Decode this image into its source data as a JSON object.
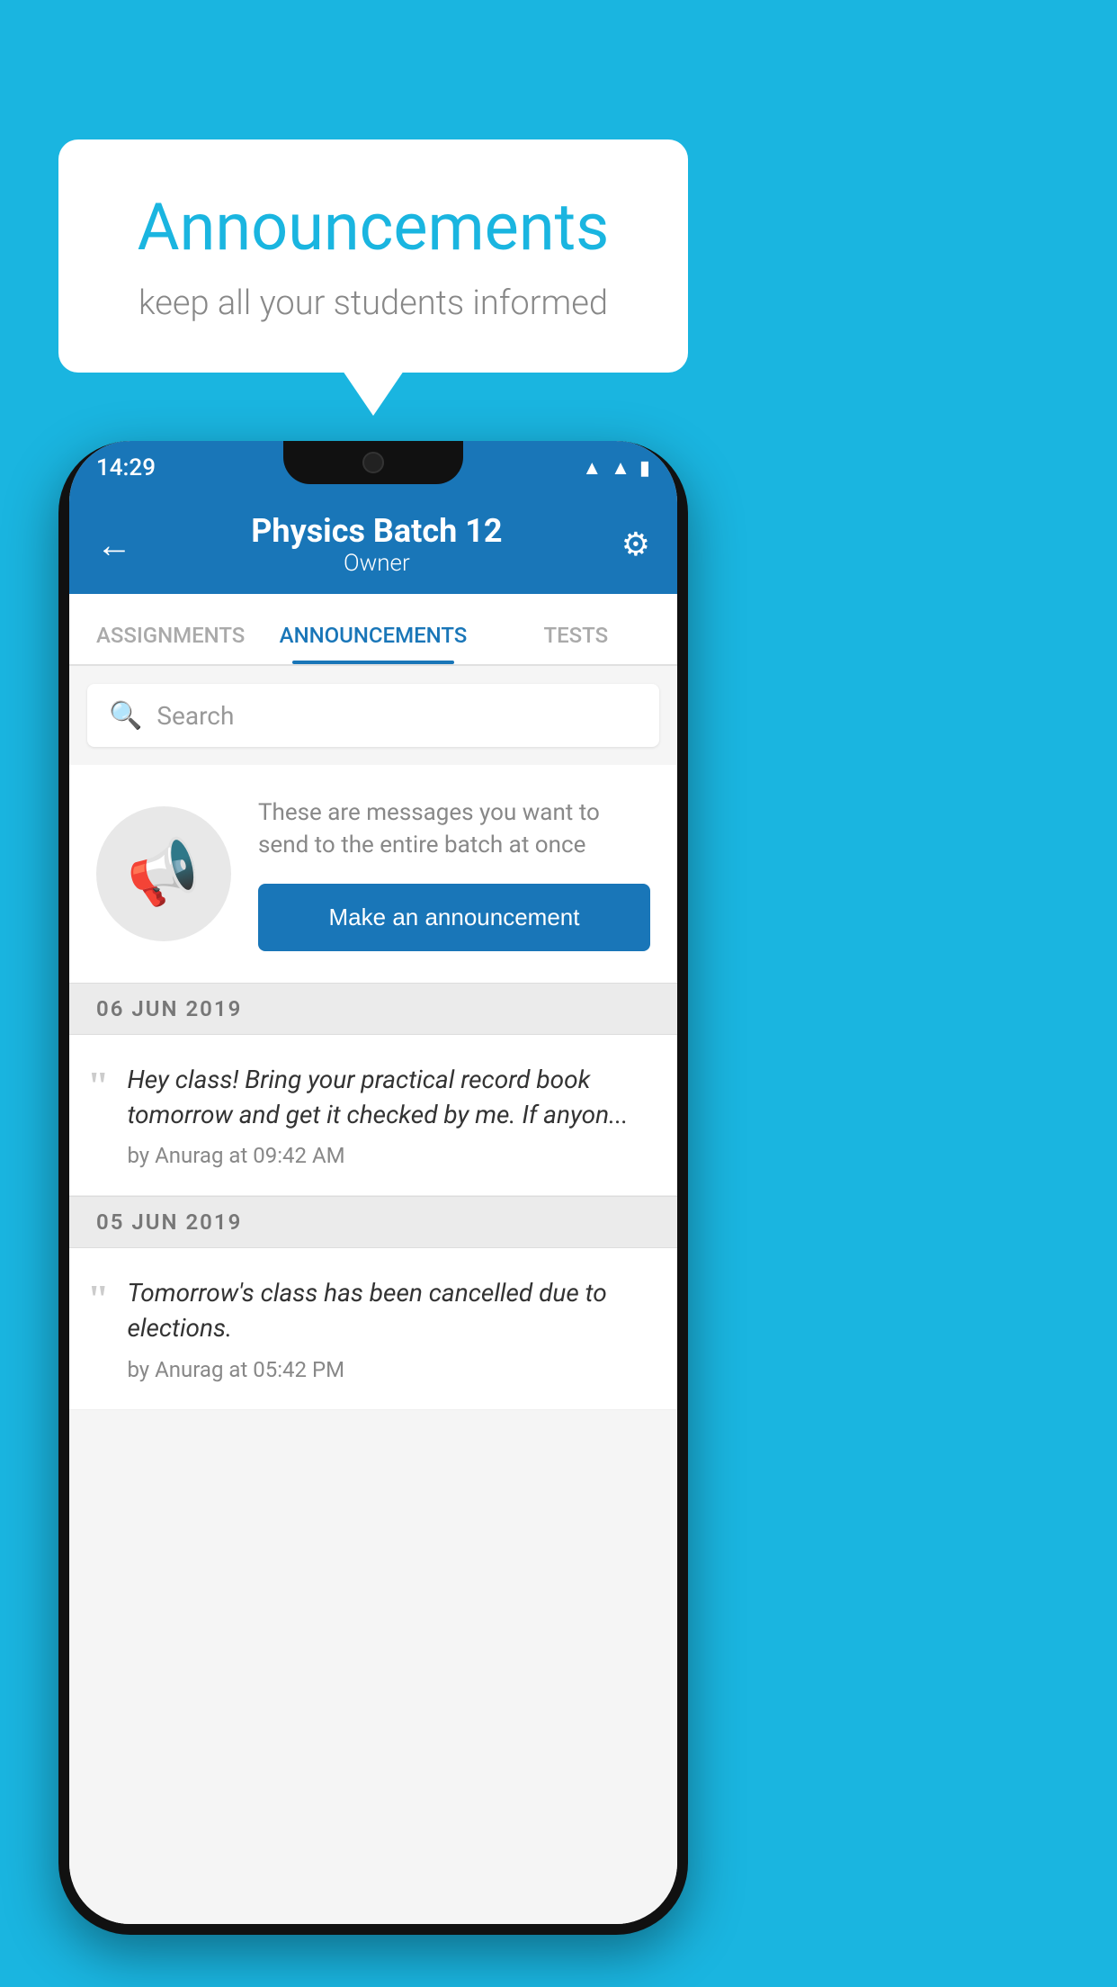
{
  "background": {
    "color": "#1ab5e0"
  },
  "speech_bubble": {
    "title": "Announcements",
    "subtitle": "keep all your students informed"
  },
  "status_bar": {
    "time": "14:29",
    "icons": [
      "wifi",
      "signal",
      "battery"
    ]
  },
  "app_bar": {
    "back_label": "←",
    "title": "Physics Batch 12",
    "subtitle": "Owner",
    "settings_label": "⚙"
  },
  "tabs": [
    {
      "label": "ASSIGNMENTS",
      "active": false
    },
    {
      "label": "ANNOUNCEMENTS",
      "active": true
    },
    {
      "label": "TESTS",
      "active": false
    }
  ],
  "search": {
    "placeholder": "Search"
  },
  "announcement_prompt": {
    "description": "These are messages you want to send to the entire batch at once",
    "button_label": "Make an announcement"
  },
  "announcements": [
    {
      "date": "06  JUN  2019",
      "items": [
        {
          "text": "Hey class! Bring your practical record book tomorrow and get it checked by me. If anyon...",
          "meta": "by Anurag at 09:42 AM"
        }
      ]
    },
    {
      "date": "05  JUN  2019",
      "items": [
        {
          "text": "Tomorrow's class has been cancelled due to elections.",
          "meta": "by Anurag at 05:42 PM"
        }
      ]
    }
  ]
}
